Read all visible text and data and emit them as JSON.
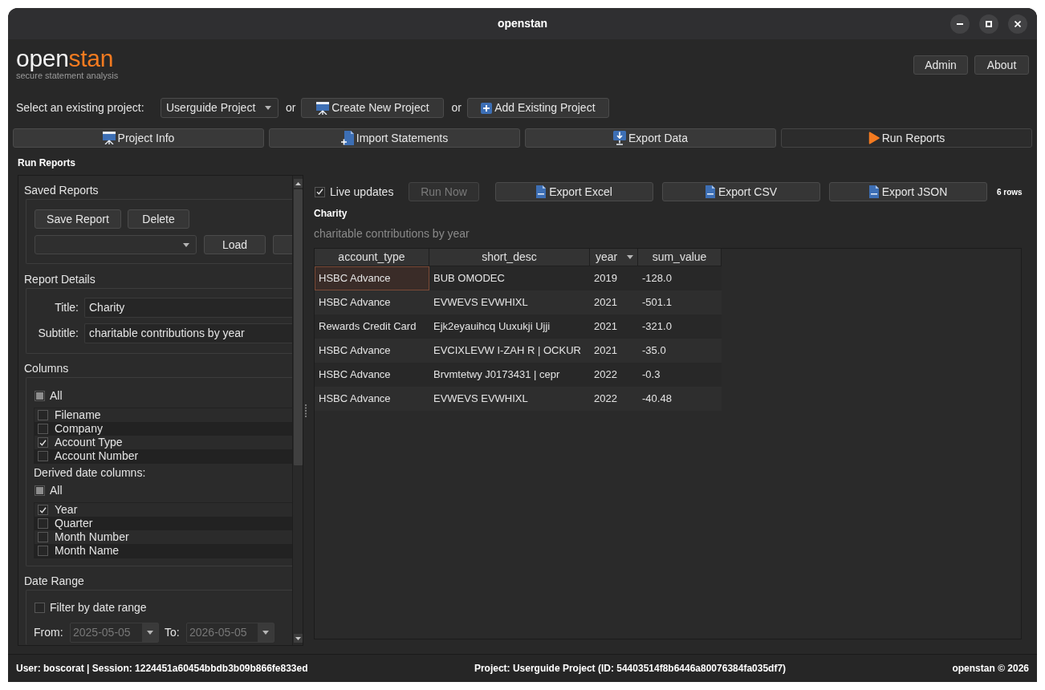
{
  "window": {
    "title": "openstan"
  },
  "header": {
    "logo": {
      "plain": "open",
      "accent": "stan"
    },
    "tagline": "secure statement analysis",
    "buttons": [
      {
        "label": "Admin"
      },
      {
        "label": "About"
      }
    ]
  },
  "project_bar": {
    "label": "Select an existing project:",
    "project_select": {
      "value": "Userguide Project"
    },
    "actions": [
      {
        "connector": "or",
        "label": "Create New Project",
        "kind": "create"
      },
      {
        "connector": "or",
        "label": "Add Existing Project",
        "kind": "add"
      }
    ]
  },
  "nav": [
    {
      "label": "Project Info",
      "kind": "info",
      "selected": false
    },
    {
      "label": "Import Statements",
      "kind": "import",
      "selected": false
    },
    {
      "label": "Export Data",
      "kind": "export",
      "selected": false
    },
    {
      "label": "Run Reports",
      "kind": "run",
      "selected": true
    }
  ],
  "section_title": "Run Reports",
  "sidebar": {
    "saved_reports": {
      "title": "Saved Reports",
      "buttons": [
        {
          "label": "Save Report"
        },
        {
          "label": "Delete"
        }
      ],
      "load_button": "Load"
    },
    "report_details": {
      "title": "Report Details",
      "fields": [
        {
          "label": "Title:",
          "value": "Charity"
        },
        {
          "label": "Subtitle:",
          "value": "charitable contributions by year"
        }
      ]
    },
    "columns": {
      "title": "Columns",
      "lists": [
        {
          "all": {
            "label": "All",
            "checked": false,
            "partial": true
          },
          "items": [
            {
              "label": "Filename",
              "checked": false
            },
            {
              "label": "Company",
              "checked": false
            },
            {
              "label": "Account Type",
              "checked": true
            },
            {
              "label": "Account Number",
              "checked": false
            }
          ]
        },
        {
          "heading": "Derived date columns:",
          "all": {
            "label": "All",
            "checked": false,
            "partial": true
          },
          "items": [
            {
              "label": "Year",
              "checked": true
            },
            {
              "label": "Quarter",
              "checked": false
            },
            {
              "label": "Month Number",
              "checked": false
            },
            {
              "label": "Month Name",
              "checked": false
            }
          ]
        }
      ]
    },
    "date_range": {
      "title": "Date Range",
      "filter": {
        "label": "Filter by date range",
        "checked": false
      },
      "fields": [
        {
          "label": "From:",
          "value": "2025-05-05",
          "disabled": true
        },
        {
          "label": "To:",
          "value": "2026-05-05",
          "disabled": true
        }
      ]
    }
  },
  "report": {
    "live_updates": {
      "label": "Live updates",
      "checked": true
    },
    "run_now": {
      "label": "Run Now",
      "disabled": true
    },
    "exports": [
      {
        "label": "Export Excel"
      },
      {
        "label": "Export CSV"
      },
      {
        "label": "Export JSON"
      }
    ],
    "row_count": "6 rows",
    "title": "Charity",
    "subtitle": "charitable contributions by year",
    "table": {
      "columns": [
        {
          "label": "account_type",
          "sorted": false
        },
        {
          "label": "short_desc",
          "sorted": false
        },
        {
          "label": "year",
          "sorted": true
        },
        {
          "label": "sum_value",
          "sorted": false
        }
      ],
      "rows": [
        {
          "cells": [
            {
              "text": "HSBC Advance",
              "selected": true
            },
            {
              "text": "BUB OMODEC",
              "selected": false
            },
            {
              "text": "2019",
              "selected": false
            },
            {
              "text": "-128.0",
              "selected": false
            }
          ]
        },
        {
          "cells": [
            {
              "text": "HSBC Advance",
              "selected": false
            },
            {
              "text": "EVWEVS EVWHIXL",
              "selected": false
            },
            {
              "text": "2021",
              "selected": false
            },
            {
              "text": "-501.1",
              "selected": false
            }
          ]
        },
        {
          "cells": [
            {
              "text": "Rewards Credit Card",
              "selected": false
            },
            {
              "text": "Ejk2eyauihcq Uuxukji Ujji",
              "selected": false
            },
            {
              "text": "2021",
              "selected": false
            },
            {
              "text": "-321.0",
              "selected": false
            }
          ]
        },
        {
          "cells": [
            {
              "text": "HSBC Advance",
              "selected": false
            },
            {
              "text": "EVCIXLEVW I-ZAH R | OCKUR",
              "selected": false
            },
            {
              "text": "2021",
              "selected": false
            },
            {
              "text": "-35.0",
              "selected": false
            }
          ]
        },
        {
          "cells": [
            {
              "text": "HSBC Advance",
              "selected": false
            },
            {
              "text": "Brvmtetwy J0173431 | cepr",
              "selected": false
            },
            {
              "text": "2022",
              "selected": false
            },
            {
              "text": "-0.3",
              "selected": false
            }
          ]
        },
        {
          "cells": [
            {
              "text": "HSBC Advance",
              "selected": false
            },
            {
              "text": "EVWEVS EVWHIXL",
              "selected": false
            },
            {
              "text": "2022",
              "selected": false
            },
            {
              "text": "-40.48",
              "selected": false
            }
          ]
        }
      ]
    }
  },
  "status_bar": {
    "user_session": "User: boscorat | Session: 1224451a60454bbdb3b09b866fe833ed",
    "project": "Project: Userguide Project (ID: 54403514f8b6446a80076384fa035df7)",
    "copyright": "openstan © 2026"
  }
}
